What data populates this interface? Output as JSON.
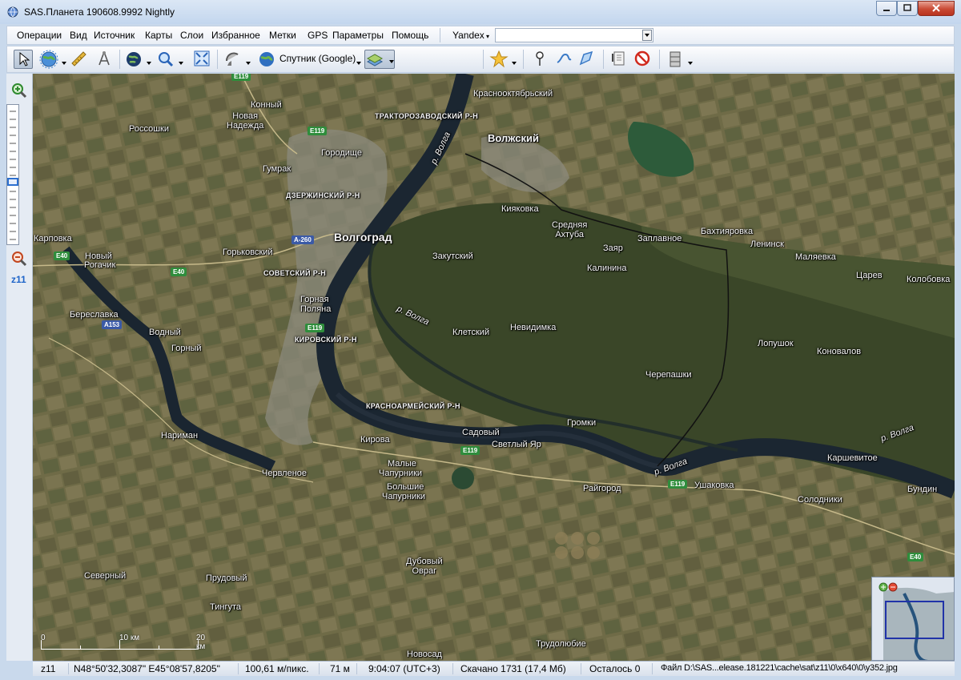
{
  "window": {
    "title": "SAS.Планета 190608.9992 Nightly"
  },
  "menu": {
    "items": [
      "Операции",
      "Вид",
      "Источник",
      "Карты",
      "Слои",
      "Избранное",
      "Метки",
      "GPS",
      "Параметры",
      "Помощь"
    ],
    "search_provider": "Yandex",
    "search_value": ""
  },
  "toolbar": {
    "map_source": "Спутник (Google)"
  },
  "zoom": {
    "label": "z11",
    "level": 11
  },
  "map": {
    "places": [
      "Конный",
      "Новая Надежда",
      "Россошки",
      "Городище",
      "Гумрак",
      "Карповка",
      "Новый",
      "Рогачик",
      "Горьковский",
      "Волгоград",
      "Закутский",
      "Кировский",
      "Береславка",
      "Водный",
      "Горный",
      "Нариман",
      "Червленое",
      "Кирова",
      "Малые Чапурники",
      "Большие Чапурники",
      "Садовый",
      "Светлый Яр",
      "Громки",
      "Райгород",
      "Ушаковка",
      "Солодники",
      "Каршевитое",
      "Бундин",
      "Дубовый Овраг",
      "Северный",
      "Прудовый",
      "Тингута",
      "Трудолюбие",
      "Новосад",
      "Волжский",
      "Краснооктябрьский",
      "Кияковка",
      "Средняя Ахтуба",
      "Заплавное",
      "Бахтияровка",
      "Ленинск",
      "Маляевка",
      "Царев",
      "Колобовка",
      "Заяр",
      "Калинина",
      "Невидимка",
      "Клетский",
      "Черепашки",
      "Лопушок",
      "Коновалов",
      "Горная Поляна"
    ],
    "districts": [
      "ТРАКТОРОЗАВОДСКИЙ Р-Н",
      "ДЗЕРЖИНСКИЙ Р-Н",
      "СОВЕТСКИЙ Р-Н",
      "КИРОВСКИЙ Р-Н",
      "КРАСНОАРМЕЙСКИЙ Р-Н"
    ],
    "river": "р. Волга",
    "roads": [
      "E119",
      "E40",
      "A-260",
      "A153"
    ],
    "scale": {
      "zero": "0",
      "mid": "10 км",
      "end": "20 км"
    }
  },
  "status": {
    "zoom": "z11",
    "coords": "N48°50'32,3087\" E45°08'57,8205\"",
    "resolution": "100,61 м/пикс.",
    "altitude": "71 м",
    "time": "9:04:07 (UTC+3)",
    "downloaded": "Скачано 1731 (17,4 Мб)",
    "remaining": "Осталось 0",
    "file": "Файл D:\\SAS...elease.181221\\cache\\sat\\z11\\0\\x640\\0\\y352.jpg"
  },
  "colors": {
    "accent": "#1e64c8",
    "land": "#6b6a46",
    "water": "#1d2a36",
    "floodplain": "#39452a"
  }
}
